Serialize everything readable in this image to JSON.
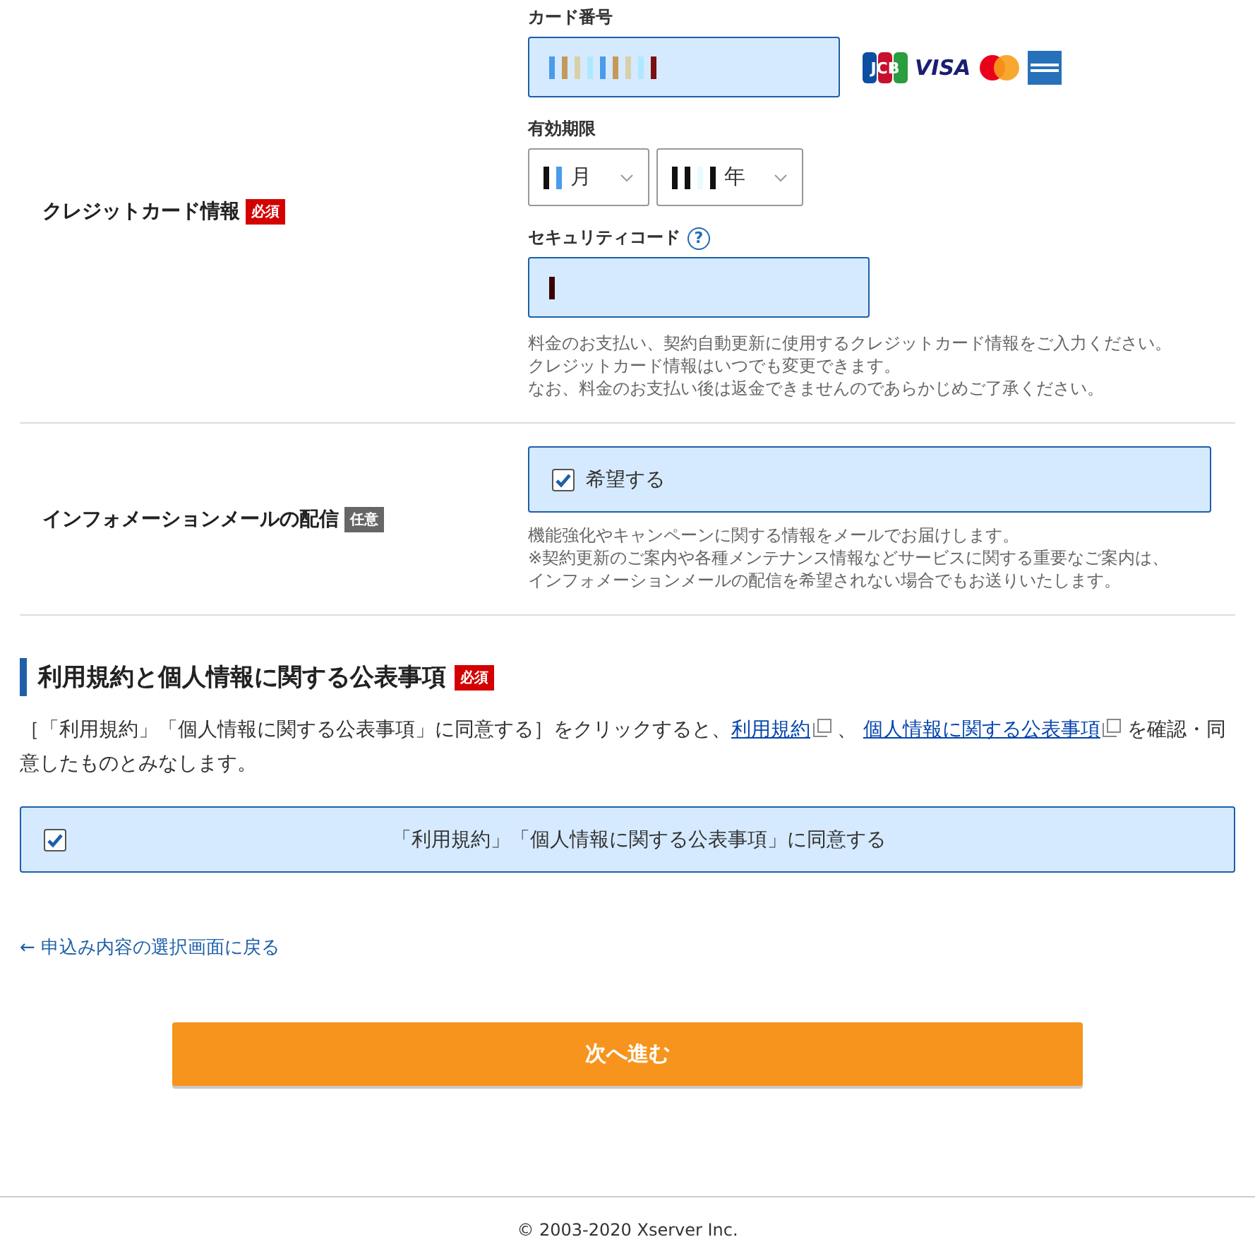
{
  "credit_card": {
    "label": "クレジットカード情報",
    "badge": {
      "kind": "required",
      "text": "必須"
    },
    "card_number": {
      "label": "カード番号"
    },
    "brands": [
      {
        "kind": "jcb",
        "text": "JCB"
      },
      {
        "kind": "visa",
        "text": "VISA"
      },
      {
        "kind": "mastercard"
      },
      {
        "kind": "amex"
      }
    ],
    "expiry": {
      "label": "有効期限",
      "month_unit": "月",
      "year_unit": "年"
    },
    "security_code": {
      "label": "セキュリティコード",
      "help": "?"
    },
    "notes": [
      "料金のお支払い、契約自動更新に使用するクレジットカード情報をご入力ください。",
      "クレジットカード情報はいつでも変更できます。",
      "なお、料金のお支払い後は返金できませんのであらかじめご了承ください。"
    ]
  },
  "info_mail": {
    "label": "インフォメーションメールの配信",
    "badge": {
      "kind": "optional",
      "text": "任意"
    },
    "option": {
      "label": "希望する",
      "checked": true
    },
    "notes": [
      "機能強化やキャンペーンに関する情報をメールでお届けします。",
      "※契約更新のご案内や各種メンテナンス情報などサービスに関する重要なご案内は、",
      "インフォメーションメールの配信を希望されない場合でもお送りいたします。"
    ]
  },
  "terms": {
    "heading": "利用規約と個人情報に関する公表事項",
    "badge": {
      "kind": "required",
      "text": "必須"
    },
    "text_before": "［「利用規約」「個人情報に関する公表事項」に同意する］をクリックすると、",
    "link_1": "利用規約",
    "separator": "、",
    "link_2": "個人情報に関する公表事項",
    "text_after": "を確認・同意したものとみなします。",
    "agree": {
      "label": "「利用規約」「個人情報に関する公表事項」に同意する",
      "checked": true
    }
  },
  "back_link": "← 申込み内容の選択画面に戻る",
  "next_button": "次へ進む",
  "footer": "© 2003-2020 Xserver Inc."
}
